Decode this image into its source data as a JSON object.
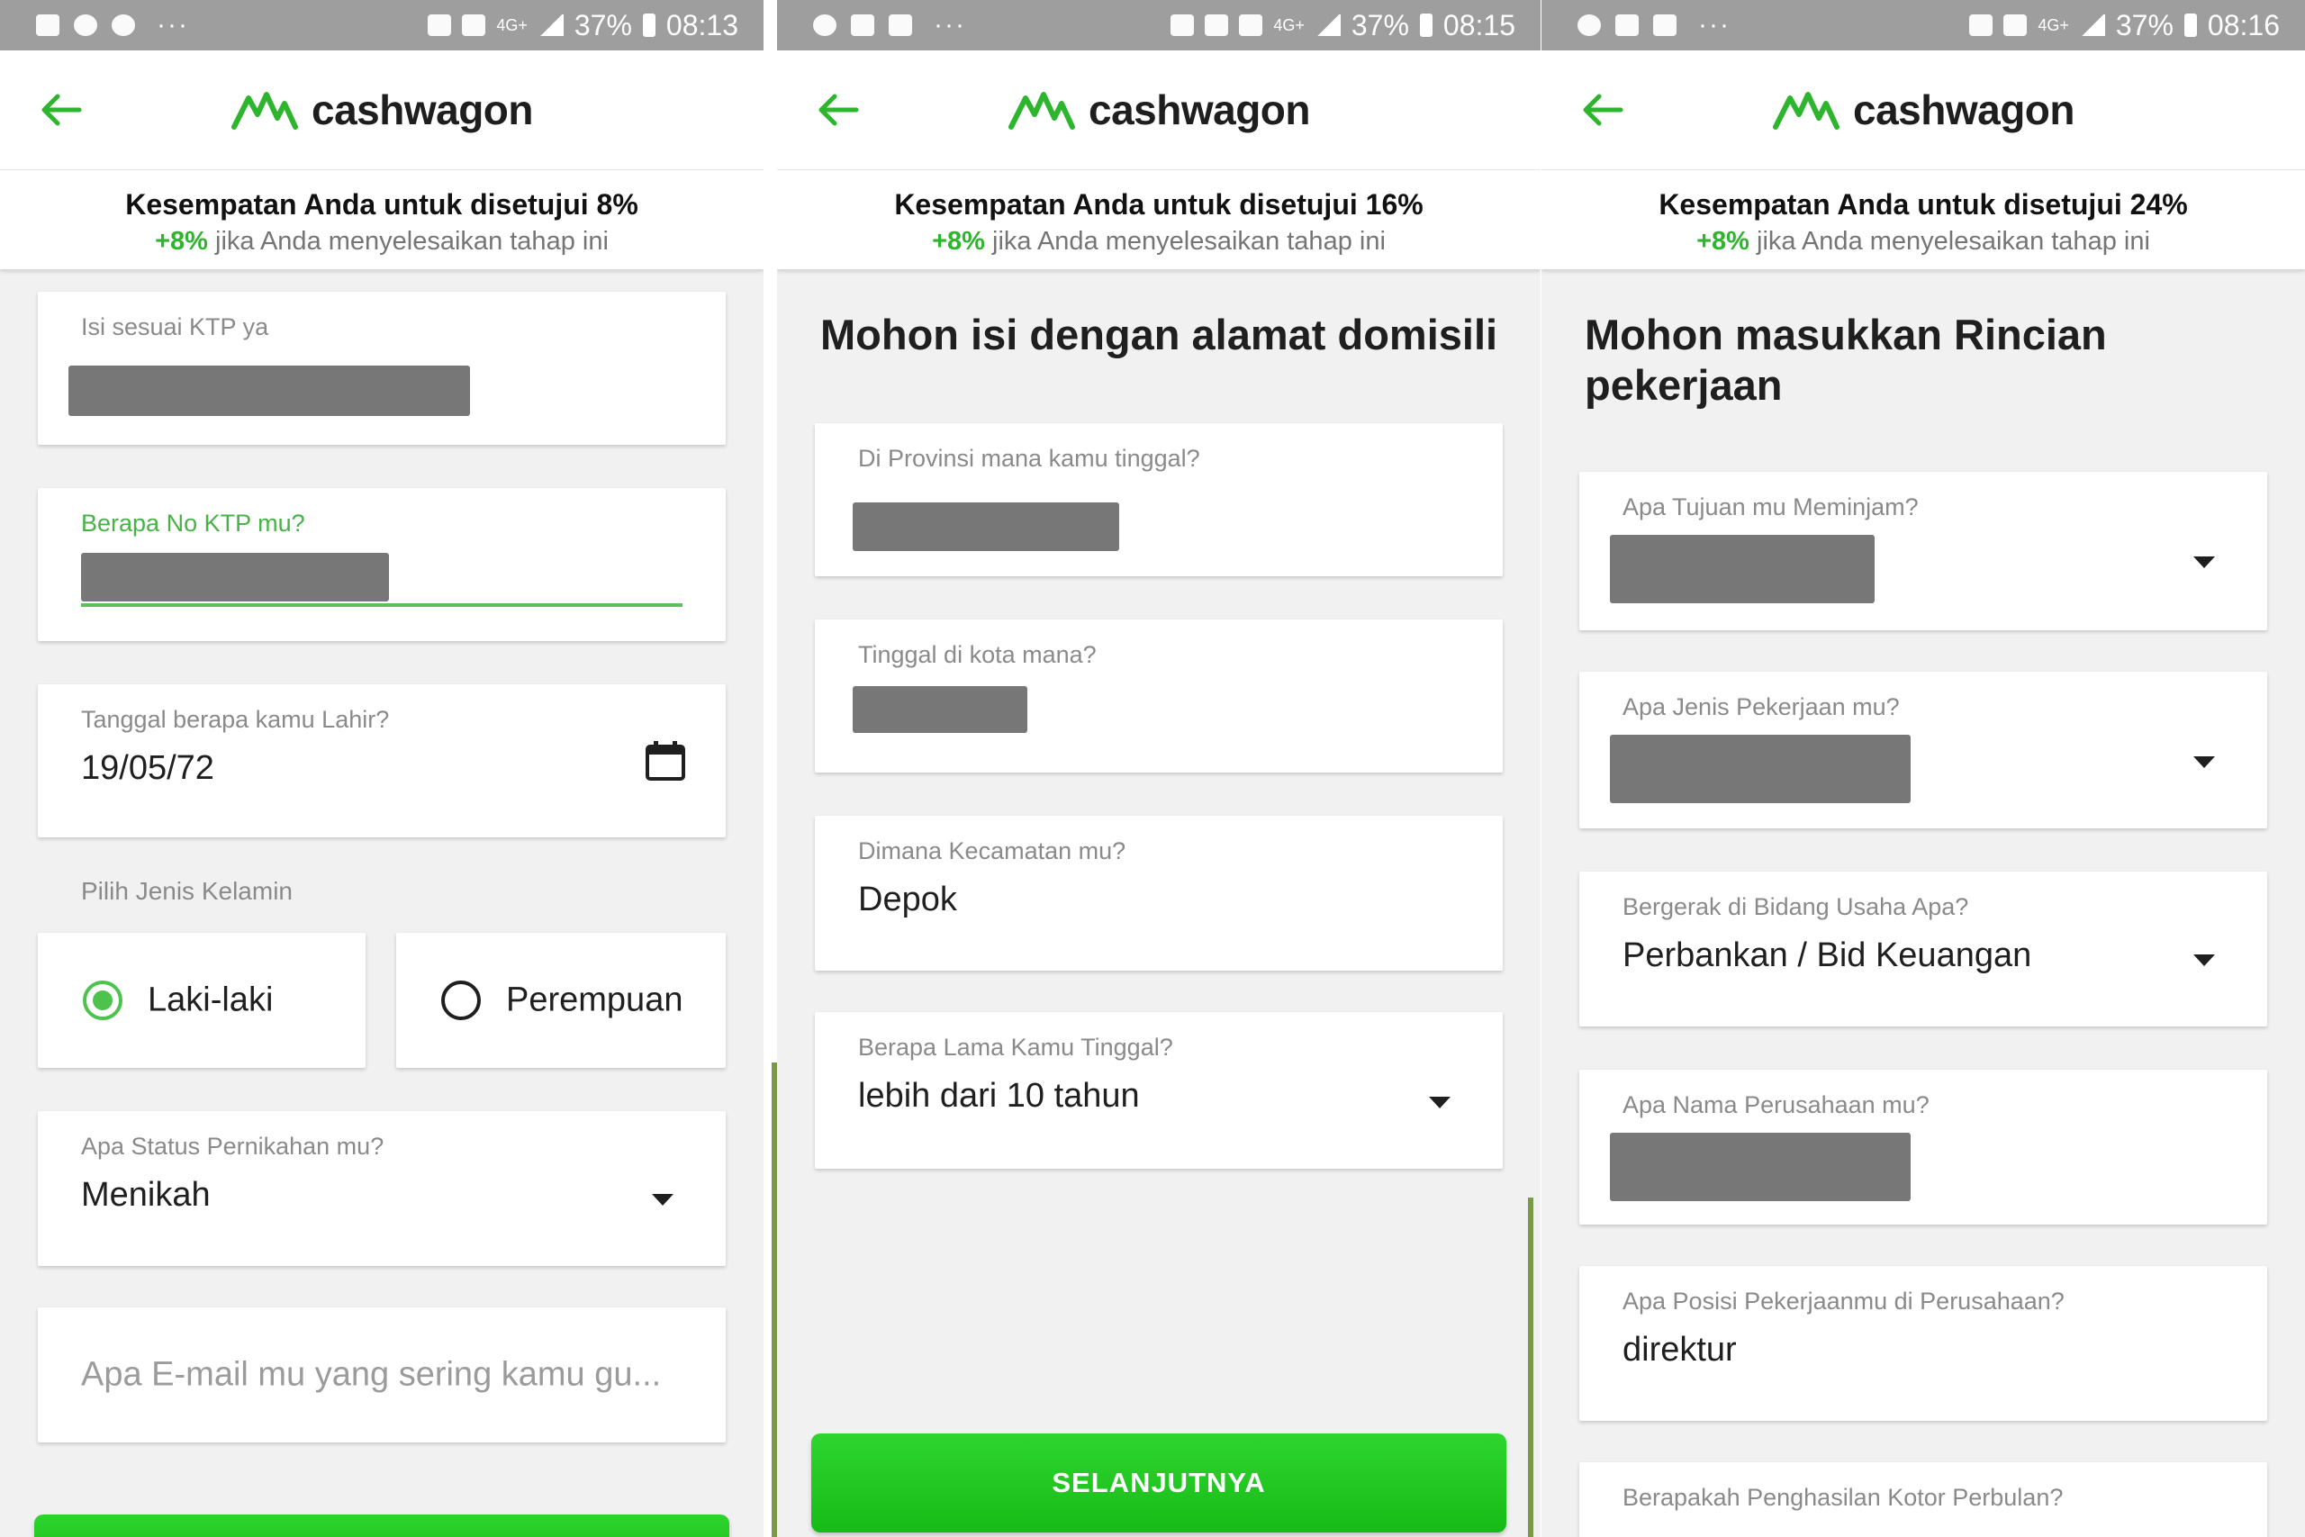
{
  "colors": {
    "accent": "#2db52d",
    "button": "#1fc81f",
    "redaction": "#777777",
    "statusbar": "#9e9e9e"
  },
  "brand": {
    "name": "cashwagon"
  },
  "screens": [
    {
      "status": {
        "battery": "37%",
        "time": "08:13",
        "network": "4G+"
      },
      "chance": {
        "title": "Kesempatan Anda untuk disetujui 8%",
        "plus": "+8%",
        "sub": " jika Anda menyelesaikan tahap ini"
      },
      "fields": {
        "name_label": "Isi sesuai KTP ya",
        "ktp_label": "Berapa No KTP mu?",
        "dob_label": "Tanggal berapa kamu Lahir?",
        "dob_value": "19/05/72",
        "gender_label": "Pilih Jenis Kelamin",
        "gender_male": "Laki-laki",
        "gender_female": "Perempuan",
        "gender_selected": "Laki-laki",
        "marital_label": "Apa Status Pernikahan mu?",
        "marital_value": "Menikah",
        "email_placeholder": "Apa E-mail mu yang sering kamu gu..."
      }
    },
    {
      "status": {
        "battery": "37%",
        "time": "08:15",
        "network": "4G+"
      },
      "chance": {
        "title": "Kesempatan Anda untuk disetujui 16%",
        "plus": "+8%",
        "sub": " jika Anda menyelesaikan tahap ini"
      },
      "heading": "Mohon isi dengan alamat domisili",
      "fields": {
        "province_label": "Di Provinsi mana kamu tinggal?",
        "city_label": "Tinggal di kota mana?",
        "district_label": "Dimana Kecamatan mu?",
        "district_value": "Depok",
        "duration_label": "Berapa Lama Kamu Tinggal?",
        "duration_value": "lebih dari 10 tahun"
      },
      "next_button": "SELANJUTNYA"
    },
    {
      "status": {
        "battery": "37%",
        "time": "08:16",
        "network": "4G+"
      },
      "chance": {
        "title": "Kesempatan Anda untuk disetujui 24%",
        "plus": "+8%",
        "sub": " jika Anda menyelesaikan tahap ini"
      },
      "heading_line1": "Mohon masukkan Rincian",
      "heading_line2": "pekerjaan",
      "fields": {
        "purpose_label": "Apa Tujuan mu Meminjam?",
        "job_type_label": "Apa Jenis Pekerjaan mu?",
        "industry_label": "Bergerak di Bidang Usaha Apa?",
        "industry_value": "Perbankan / Bid Keuangan",
        "company_label": "Apa Nama Perusahaan mu?",
        "position_label": "Apa Posisi Pekerjaanmu di Perusahaan?",
        "position_value": "direktur",
        "income_label": "Berapakah Penghasilan Kotor Perbulan?"
      }
    }
  ]
}
